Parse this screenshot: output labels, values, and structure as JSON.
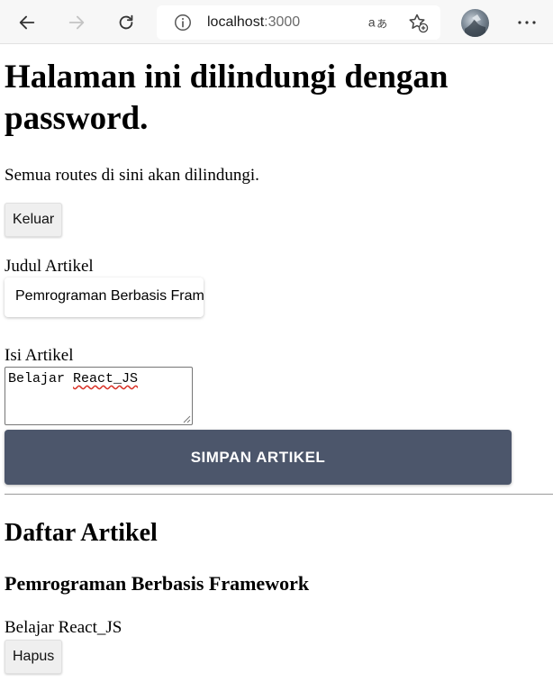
{
  "browser": {
    "url_host": "localhost",
    "url_port": ":3000"
  },
  "page": {
    "title": "Halaman ini dilindungi dengan password.",
    "subtitle": "Semua routes di sini akan dilindungi.",
    "logout_label": "Keluar"
  },
  "form": {
    "title_label": "Judul Artikel",
    "title_value": "Pemrograman Berbasis Framework",
    "body_label": "Isi Artikel",
    "body_value_prefix": "Belajar ",
    "body_value_misspelled": "React_JS",
    "save_label": "SIMPAN ARTIKEL"
  },
  "articles": {
    "heading": "Daftar Artikel",
    "items": [
      {
        "title": "Pemrograman Berbasis Framework",
        "body": "Belajar React_JS",
        "delete_label": "Hapus"
      }
    ]
  }
}
